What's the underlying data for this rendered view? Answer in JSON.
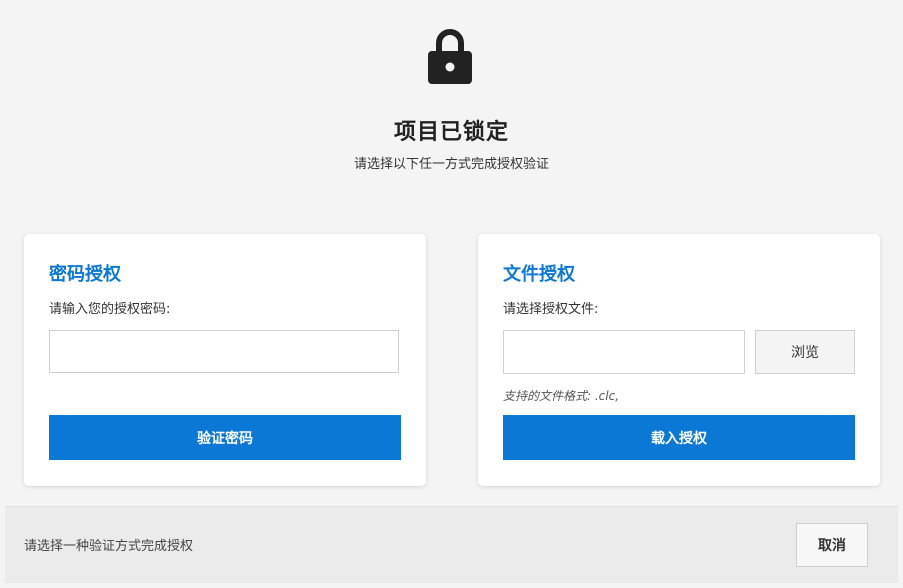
{
  "header": {
    "icon": "lock-icon",
    "title": "项目已锁定",
    "subtitle": "请选择以下任一方式完成授权验证"
  },
  "password_card": {
    "title": "密码授权",
    "label": "请输入您的授权密码:",
    "input_value": "",
    "input_placeholder": "",
    "verify_label": "验证密码"
  },
  "file_card": {
    "title": "文件授权",
    "label": "请选择授权文件:",
    "input_value": "",
    "input_placeholder": "",
    "browse_label": "浏览",
    "hint": "支持的文件格式: .clc,",
    "load_label": "载入授权"
  },
  "footer": {
    "status": "请选择一种验证方式完成授权",
    "cancel_label": "取消"
  },
  "colors": {
    "accent": "#0a78d4",
    "background": "#f4f4f4",
    "card": "#ffffff"
  }
}
